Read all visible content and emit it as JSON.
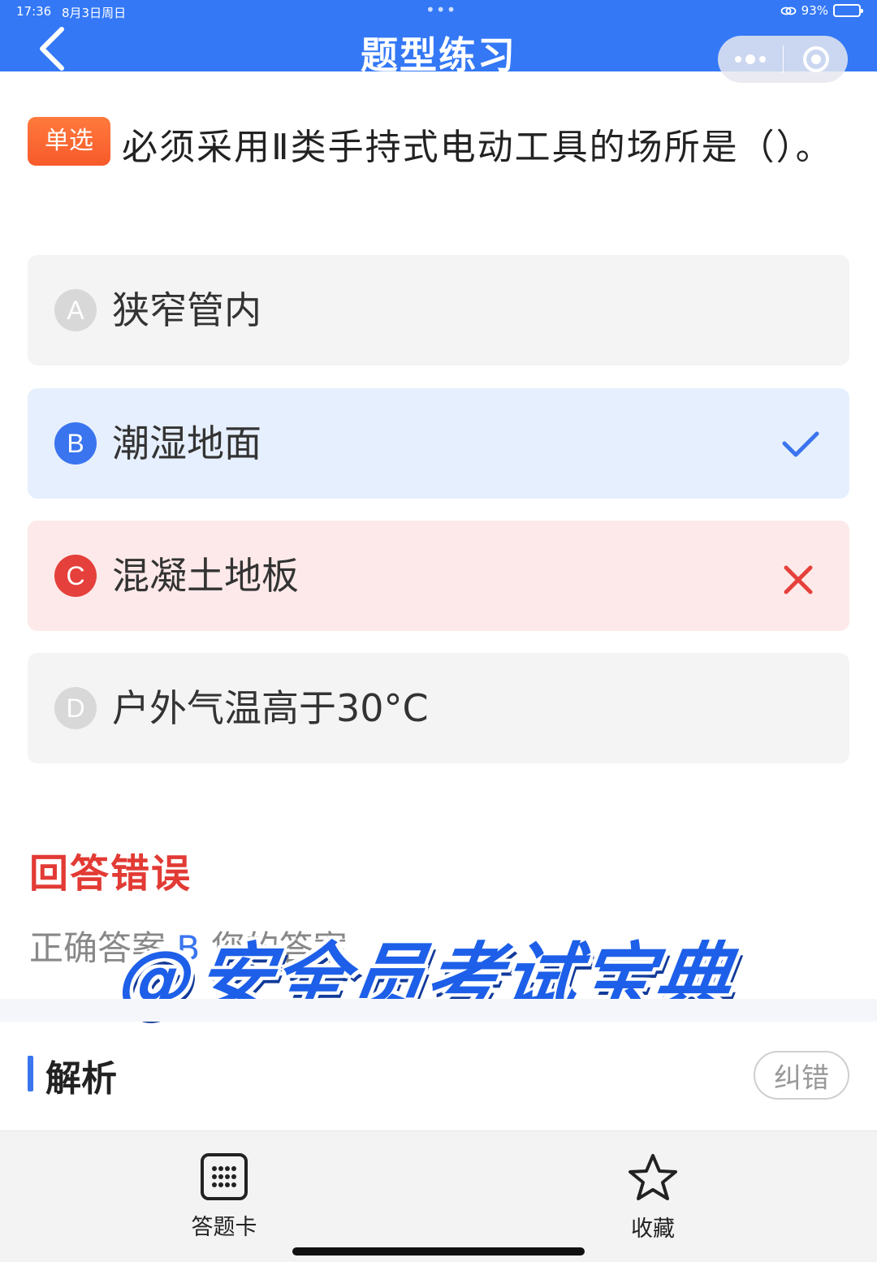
{
  "status_bar": {
    "time": "17:36",
    "date": "8月3日周日",
    "battery": "93%"
  },
  "header": {
    "title": "题型练习"
  },
  "question": {
    "type_badge": "单选",
    "text": "必须采用Ⅱ类手持式电动工具的场所是（）。"
  },
  "options": [
    {
      "letter": "A",
      "text": "狭窄管内",
      "state": "normal"
    },
    {
      "letter": "B",
      "text": "潮湿地面",
      "state": "correct"
    },
    {
      "letter": "C",
      "text": "混凝土地板",
      "state": "wrong"
    },
    {
      "letter": "D",
      "text": "户外气温高于30°C",
      "state": "normal"
    }
  ],
  "result": {
    "title": "回答错误",
    "answer_prefix": "正确答案",
    "answer_value": "B",
    "answer_suffix": "您的答案"
  },
  "watermark": "@安全员考试宝典",
  "analysis": {
    "title": "解析",
    "report_label": "纠错"
  },
  "bottom_tabs": [
    {
      "label": "答题卡",
      "icon": "grid-icon"
    },
    {
      "label": "收藏",
      "icon": "star-icon"
    }
  ],
  "colors": {
    "primary": "#3478f6",
    "correct": "#3a74ef",
    "wrong": "#e23a34",
    "badge": "#f75a2a"
  }
}
